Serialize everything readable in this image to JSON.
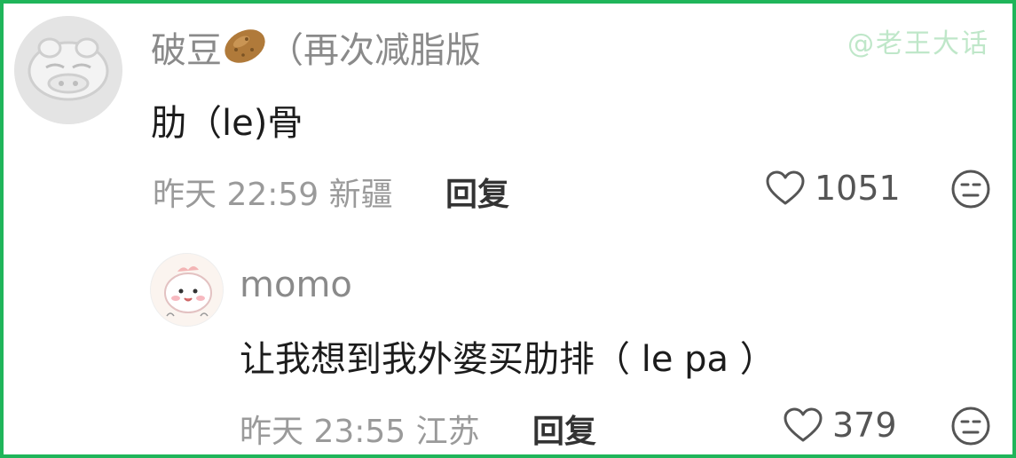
{
  "watermark": "@老王大话",
  "comment": {
    "user": "破豆",
    "user_suffix": "（再次减脂版",
    "text": "肋（le)骨",
    "time": "昨天 22:59",
    "location": "新疆",
    "reply_label": "回复",
    "likes": "1051"
  },
  "reply": {
    "user": "momo",
    "text": "让我想到我外婆买肋排（ le pa ）",
    "time": "昨天 23:55",
    "location": "江苏",
    "reply_label": "回复",
    "likes": "379"
  },
  "icons": {
    "like": "heart-outline-icon",
    "dislike": "neutral-face-icon",
    "emoji": "potato-emoji"
  }
}
